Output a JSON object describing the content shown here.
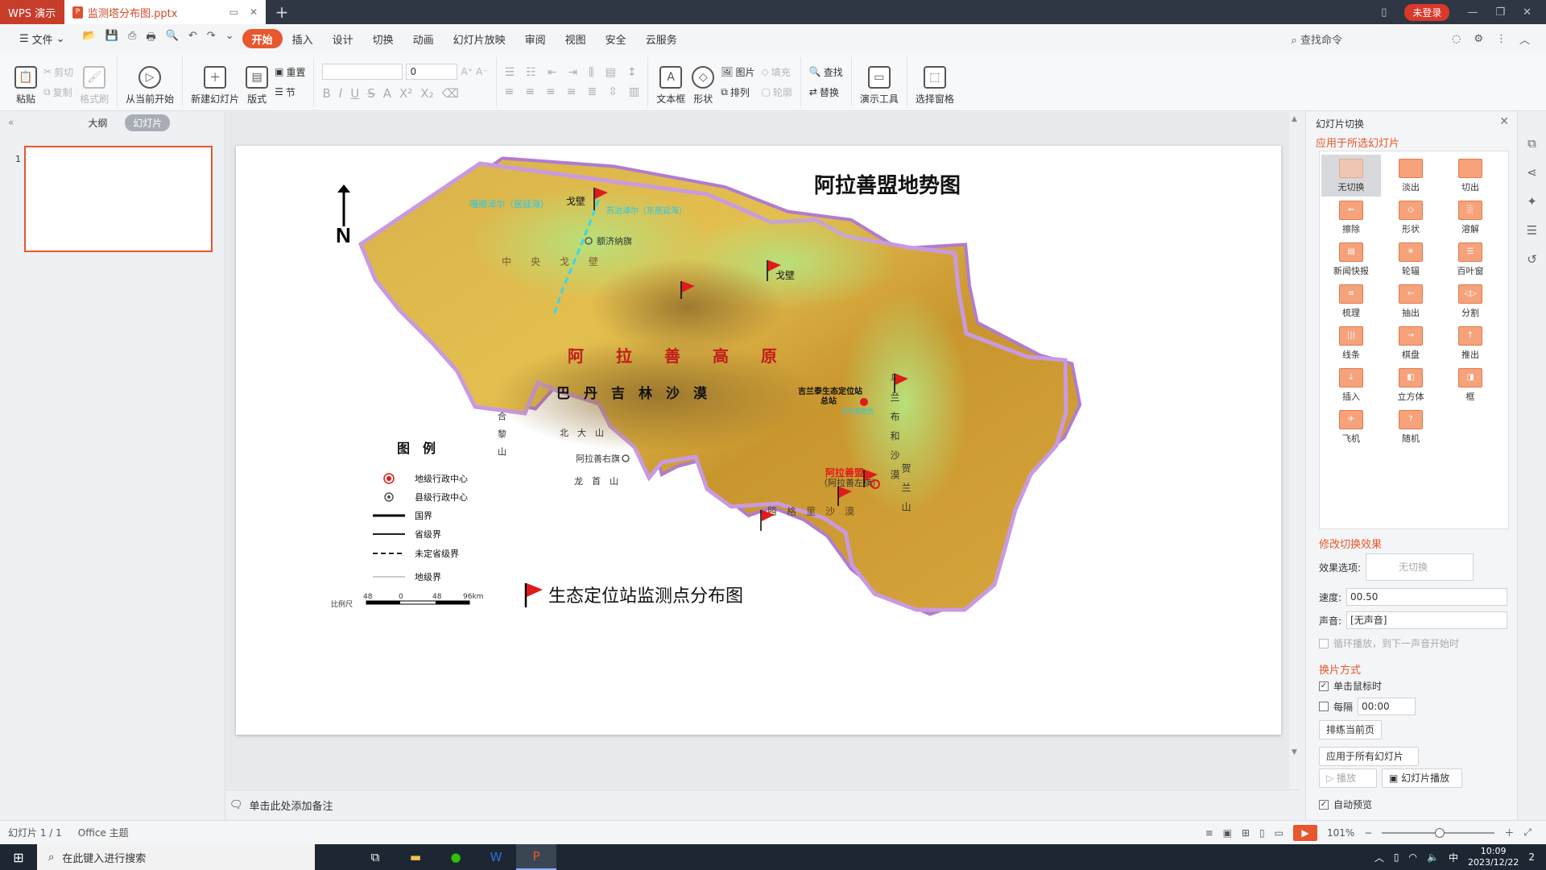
{
  "titlebar": {
    "app_tab": "WPS 演示",
    "doc_tab": "监测塔分布图.pptx",
    "login": "未登录"
  },
  "menubar": {
    "file": "文件",
    "items": [
      "开始",
      "插入",
      "设计",
      "切换",
      "动画",
      "幻灯片放映",
      "审阅",
      "视图",
      "安全",
      "云服务"
    ],
    "search": "查找命令"
  },
  "ribbon": {
    "paste": "粘贴",
    "cut": "剪切",
    "copy": "复制",
    "format_painter": "格式刷",
    "play_from_current": "从当前开始",
    "new_slide": "新建幻灯片",
    "layout": "版式",
    "reset": "重置",
    "section": "节",
    "font_size": "0",
    "textbox": "文本框",
    "shape": "形状",
    "picture": "图片",
    "arrange": "排列",
    "fill": "填充",
    "outline": "轮廓",
    "find": "查找",
    "replace": "替换",
    "tools": "演示工具",
    "select_pane": "选择窗格"
  },
  "leftpane": {
    "outline_tab": "大纲",
    "slides_tab": "幻灯片",
    "thumb_num": "1"
  },
  "notes": {
    "placeholder": "单击此处添加备注"
  },
  "slide": {
    "title": "阿拉善盟地势图",
    "north": "N",
    "legend_title": "图　例",
    "legend": [
      "地级行政中心",
      "县级行政中心",
      "国界",
      "省级界",
      "未定省级界",
      "地级界"
    ],
    "scale_label": "比例尺",
    "scale_ticks": [
      "48",
      "0",
      "48",
      "96km"
    ],
    "bottom_caption": "生态定位站监测点分布图",
    "labels": {
      "plateau": "阿　　拉　　善　　高　　原",
      "badain": "巴　丹　吉　林　沙　漠",
      "gobi1": "戈壁",
      "gobi2": "戈壁",
      "ejina": "额济纳旗",
      "central_gobi": "中　　央　　戈　　壁",
      "juyan_w": "嘎顺淖尔（居延海）",
      "juyan_e": "苏泊淖尔（东居延海）",
      "alxa_right": "阿拉善右旗",
      "station": "吉兰泰生态定位站",
      "station2": "总站",
      "league": "阿拉善盟",
      "league2": "（阿拉善左旗）",
      "ulan": "乌　兰　布　和　沙　漠",
      "tengger": "腾　格　里　沙　漠",
      "helan": "贺　兰　山",
      "heli": "合　黎　山",
      "beida": "北　大　山",
      "longshou": "龙　首　山",
      "jilantai": "吉兰泰盐池"
    }
  },
  "rpanel": {
    "title": "幻灯片切换",
    "subtitle": "应用于所选幻灯片",
    "transitions": [
      "无切换",
      "淡出",
      "切出",
      "擦除",
      "形状",
      "溶解",
      "新闻快报",
      "轮辐",
      "百叶窗",
      "梳理",
      "抽出",
      "分割",
      "线条",
      "棋盘",
      "推出",
      "插入",
      "立方体",
      "框",
      "飞机",
      "随机"
    ],
    "modify": "修改切换效果",
    "effect_label": "效果选项:",
    "effect_value": "无切换",
    "speed_label": "速度:",
    "speed_value": "00.50",
    "sound_label": "声音:",
    "sound_value": "[无声音]",
    "loop": "循环播放，到下一声音开始时",
    "advance": "换片方式",
    "on_click": "单击鼠标时",
    "every": "每隔",
    "every_value": "00:00",
    "rehearse": "排练当前页",
    "apply_all": "应用于所有幻灯片",
    "play": "播放",
    "slideshow": "幻灯片播放",
    "auto_preview": "自动预览"
  },
  "statusbar": {
    "slide_info": "幻灯片 1 / 1",
    "theme": "Office 主题",
    "zoom": "101%"
  },
  "taskbar": {
    "search": "在此键入进行搜索",
    "ime": "中",
    "time": "10:09",
    "date": "2023/12/22",
    "notif": "2"
  }
}
